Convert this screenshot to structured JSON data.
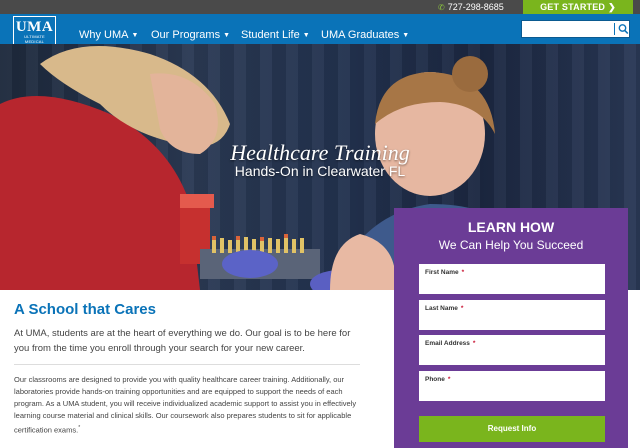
{
  "topbar": {
    "phone": "727-298-8685",
    "phone_icon": "phone-icon",
    "cta": "GET STARTED",
    "cta_icon": "chevron-right-icon"
  },
  "brand": {
    "name": "UMA",
    "sub_lines": [
      "ULTIMATE",
      "MEDICAL",
      "ACADEMY"
    ]
  },
  "nav": {
    "items": [
      {
        "label": "Why UMA"
      },
      {
        "label": "Our Programs"
      },
      {
        "label": "Student Life"
      },
      {
        "label": "UMA Graduates"
      }
    ],
    "search": {
      "value": "",
      "placeholder": "",
      "icon": "search-icon"
    }
  },
  "hero": {
    "title": "Healthcare Training",
    "subtitle": "Hands-On in Clearwater FL"
  },
  "form": {
    "heading": "LEARN HOW",
    "subheading": "We Can Help You Succeed",
    "fields": [
      {
        "label": "First Name",
        "required_mark": "*"
      },
      {
        "label": "Last Name",
        "required_mark": "*"
      },
      {
        "label": "Email Address",
        "required_mark": "*"
      },
      {
        "label": "Phone",
        "required_mark": "*"
      }
    ],
    "submit": "Request Info"
  },
  "content": {
    "title": "A School that Cares",
    "intro": "At UMA, students are at the heart of everything we do. Our goal is to be here for you from the time you enroll through your search for your new career.",
    "body": "Our classrooms are designed to provide you with quality healthcare career training. Additionally, our laboratories provide hands-on training opportunities and are equipped to support the needs of each program. As a UMA student, you will receive individualized academic support to assist you in effectively learning course material and clinical skills. Our coursework also prepares students to sit for applicable certification exams.",
    "footnote_mark": "*"
  },
  "colors": {
    "nav_blue": "#0a73b8",
    "cta_green": "#7ab51d",
    "form_purple": "#6b3c96",
    "topbar_gray": "#4a4a4a"
  }
}
